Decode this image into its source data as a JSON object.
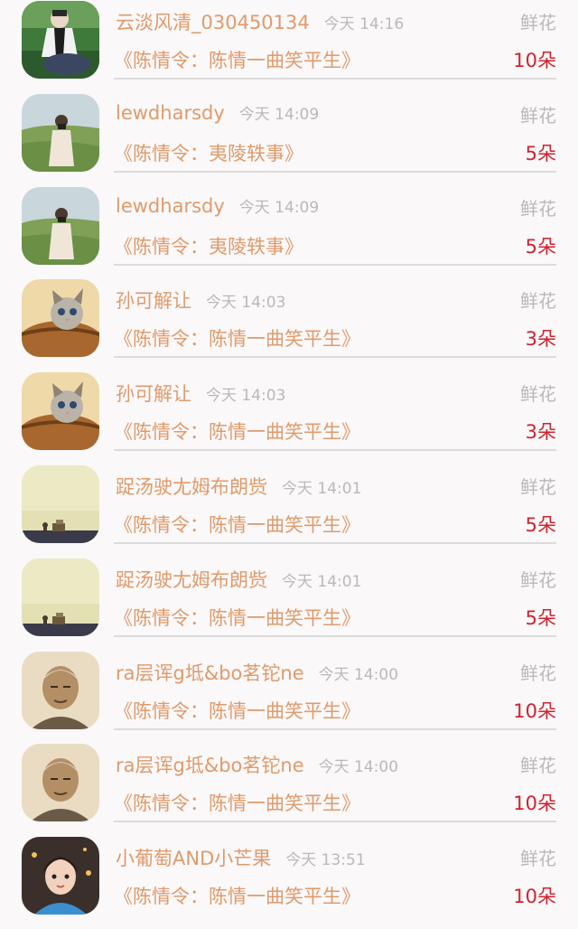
{
  "records": [
    {
      "user": "云淡风清_030450134",
      "time": "今天 14:16",
      "gift": "鲜花",
      "book": "《陈情令：陈情一曲笑平生》",
      "count": "10朵",
      "avatar": "person-park-avatar"
    },
    {
      "user": "lewdharsdy",
      "time": "今天 14:09",
      "gift": "鲜花",
      "book": "《陈情令：夷陵轶事》",
      "count": "5朵",
      "avatar": "photographer-field-avatar"
    },
    {
      "user": "lewdharsdy",
      "time": "今天 14:09",
      "gift": "鲜花",
      "book": "《陈情令：夷陵轶事》",
      "count": "5朵",
      "avatar": "photographer-field-avatar"
    },
    {
      "user": "孙可解让",
      "time": "今天 14:03",
      "gift": "鲜花",
      "book": "《陈情令：陈情一曲笑平生》",
      "count": "3朵",
      "avatar": "kitten-basket-avatar"
    },
    {
      "user": "孙可解让",
      "time": "今天 14:03",
      "gift": "鲜花",
      "book": "《陈情令：陈情一曲笑平生》",
      "count": "3朵",
      "avatar": "kitten-basket-avatar"
    },
    {
      "user": "踀汤驶尢姆布朗赀",
      "time": "今天 14:01",
      "gift": "鲜花",
      "book": "《陈情令：陈情一曲笑平生》",
      "count": "5朵",
      "avatar": "sepia-landscape-avatar"
    },
    {
      "user": "踀汤驶尢姆布朗赀",
      "time": "今天 14:01",
      "gift": "鲜花",
      "book": "《陈情令：陈情一曲笑平生》",
      "count": "5朵",
      "avatar": "sepia-landscape-avatar"
    },
    {
      "user": "ra层诨g坻&bo茗铊ne",
      "time": "今天 14:00",
      "gift": "鲜花",
      "book": "《陈情令：陈情一曲笑平生》",
      "count": "10朵",
      "avatar": "elder-portrait-avatar"
    },
    {
      "user": "ra层诨g坻&bo茗铊ne",
      "time": "今天 14:00",
      "gift": "鲜花",
      "book": "《陈情令：陈情一曲笑平生》",
      "count": "10朵",
      "avatar": "elder-portrait-avatar"
    },
    {
      "user": "小葡萄AND小芒果",
      "time": "今天 13:51",
      "gift": "鲜花",
      "book": "《陈情令：陈情一曲笑平生》",
      "count": "10朵",
      "avatar": "child-portrait-avatar"
    }
  ],
  "colors": {
    "name": "#e09a6a",
    "meta": "#b9b9b9",
    "count": "#d0222e",
    "background": "#faf8f9"
  }
}
